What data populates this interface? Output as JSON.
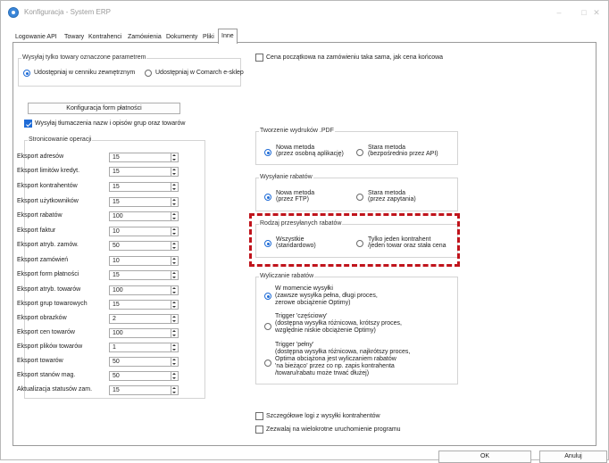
{
  "window": {
    "title": "Konfiguracja - System ERP",
    "minimize": "–",
    "maximize": "□",
    "close": "✕"
  },
  "tabs": [
    "Logowanie API",
    "Towary",
    "Kontrahenci",
    "Zamówienia",
    "Dokumenty",
    "Pliki",
    "Inne"
  ],
  "active_tab": "Inne",
  "colors": {
    "accent": "#1e6bd6",
    "highlight": "#c0141c"
  },
  "left": {
    "export_group": {
      "title": "Wysyłaj tylko towary oznaczone parametrem",
      "opt1": "Udostępniaj w cenniku zewnętrznym",
      "opt2": "Udostępniaj w Comarch e-sklep"
    },
    "payment_button": "Konfiguracja form płatności",
    "translations_check": "Wysyłaj tłumaczenia nazw i opisów grup oraz towarów",
    "paging": {
      "title": "Stronicowanie operacji",
      "rows": [
        {
          "label": "Eksport adresów",
          "value": "15"
        },
        {
          "label": "Eksport limitów kredyt.",
          "value": "15"
        },
        {
          "label": "Eksport kontrahentów",
          "value": "15"
        },
        {
          "label": "Eksport użytkowników",
          "value": "15"
        },
        {
          "label": "Eksport rabatów",
          "value": "100"
        },
        {
          "label": "Eksport faktur",
          "value": "10"
        },
        {
          "label": "Eksport atryb. zamów.",
          "value": "50"
        },
        {
          "label": "Eksport zamówień",
          "value": "10"
        },
        {
          "label": "Eksport form płatności",
          "value": "15"
        },
        {
          "label": "Eksport atryb. towarów",
          "value": "100"
        },
        {
          "label": "Eksport grup towarowych",
          "value": "15"
        },
        {
          "label": "Eksport obrazków",
          "value": "2"
        },
        {
          "label": "Eksport cen towarów",
          "value": "100"
        },
        {
          "label": "Eksport plików towarów",
          "value": "1"
        },
        {
          "label": "Eksport towarów",
          "value": "50"
        },
        {
          "label": "Eksport stanów mag.",
          "value": "50"
        },
        {
          "label": "Aktualizacja statusów zam.",
          "value": "15"
        }
      ]
    }
  },
  "right": {
    "price_check": "Cena początkowa na zamówieniu taka sama, jak cena końcowa",
    "pdf": {
      "title": "Tworzenie wydruków .PDF",
      "opt1_line1": "Nowa metoda",
      "opt1_line2": "(przez osobną aplikację)",
      "opt2_line1": "Stara metoda",
      "opt2_line2": "(bezpośrednio przez API)"
    },
    "discount_send": {
      "title": "Wysyłanie rabatów",
      "opt1_line1": "Nowa metoda",
      "opt1_line2": "(przez FTP)",
      "opt2_line1": "Stara metoda",
      "opt2_line2": "(przez zapytania)"
    },
    "discount_type": {
      "title": "Rodzaj przesyłanych rabatów",
      "opt1_line1": "Wszystkie",
      "opt1_line2": "(standardowo)",
      "opt2_line1": "Tylko jeden kontrahent",
      "opt2_line2": "/jeden towar oraz stała cena"
    },
    "discount_calc": {
      "title": "Wyliczanie rabatów",
      "opt1": [
        "W momencie wysyłki",
        "(zawsze wysyłka pełna, długi proces,",
        "zerowe obciążenie Optimy)"
      ],
      "opt2": [
        "Trigger 'częściowy'",
        "(dostępna wysyłka różnicowa, krótszy proces,",
        "względnie niskie obciążenie Optimy)"
      ],
      "opt3": [
        "Trigger 'pełny'",
        "(dostępna wysyłka różnicowa, najkrótszy proces,",
        "Optima obciążona jest wyliczaniem rabatów",
        "'na bieżąco' przez co np. zapis kontrahenta",
        "/towaru/rabatu może trwać dłużej)"
      ]
    },
    "detailed_logs": "Szczegółowe logi z wysyłki kontrahentów",
    "multi_run": "Zezwalaj na wielokrotne uruchomienie programu"
  },
  "footer": {
    "ok": "OK",
    "cancel": "Anuluj"
  }
}
